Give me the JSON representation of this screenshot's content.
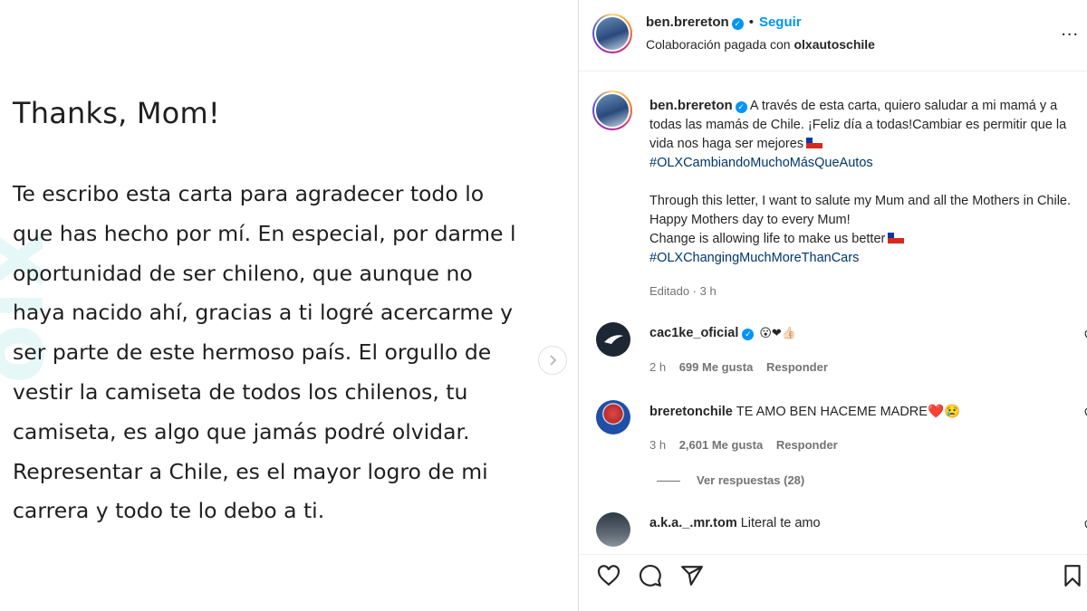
{
  "letter": {
    "watermark": "olx",
    "title": "Thanks, Mom!",
    "lines": [
      "Te escribo esta carta para agradecer todo lo",
      "que has hecho por mí. En especial, por darme l",
      "oportunidad de ser chileno, que aunque no",
      "haya nacido ahí, gracias a ti logré acercarme y",
      "ser parte de este hermoso país. El orgullo de",
      "vestir la camiseta de todos los chilenos, tu",
      "camiseta, es algo que jamás podré olvidar.",
      "Representar a Chile, es el mayor logro de mi",
      "carrera y todo te lo debo a ti."
    ]
  },
  "post": {
    "author": "ben.brereton",
    "follow_label": "Seguir",
    "separator": "•",
    "collab_prefix": "Colaboración pagada con",
    "collab_partner": "olxautoschile",
    "more_label": "...",
    "caption": {
      "username": "ben.brereton",
      "text_es": "A través de esta carta, quiero saludar a mi mamá y a todas las mamás de Chile. ¡Feliz día a todas!Cambiar es permitir que la vida nos haga ser mejores",
      "hashtag_es": "#OLXCambiandoMuchoMásQueAutos",
      "text_en_1": "Through this letter, I want to salute my Mum and all the Mothers in Chile. Happy Mothers day to every Mum!",
      "text_en_2": "Change is allowing life to make us better",
      "hashtag_en": "#OLXChangingMuchMoreThanCars",
      "edited": "Editado · 3 h"
    },
    "comments": [
      {
        "username": "cac1ke_oficial",
        "text": "😮❤👍🏻",
        "time": "2 h",
        "likes": "699 Me gusta",
        "reply": "Responder"
      },
      {
        "username": "breretonchile",
        "text": "TE AMO BEN HACEME MADRE❤️😢",
        "time": "3 h",
        "likes": "2,601 Me gusta",
        "reply": "Responder"
      },
      {
        "username": "a.k.a._.mr.tom",
        "text": "Literal te amo"
      }
    ],
    "view_replies": "Ver respuestas (28)"
  },
  "colors": {
    "link_blue": "#0095f6",
    "hashtag": "#00376b",
    "muted": "#737373",
    "watermark": "#e6f7f7"
  }
}
